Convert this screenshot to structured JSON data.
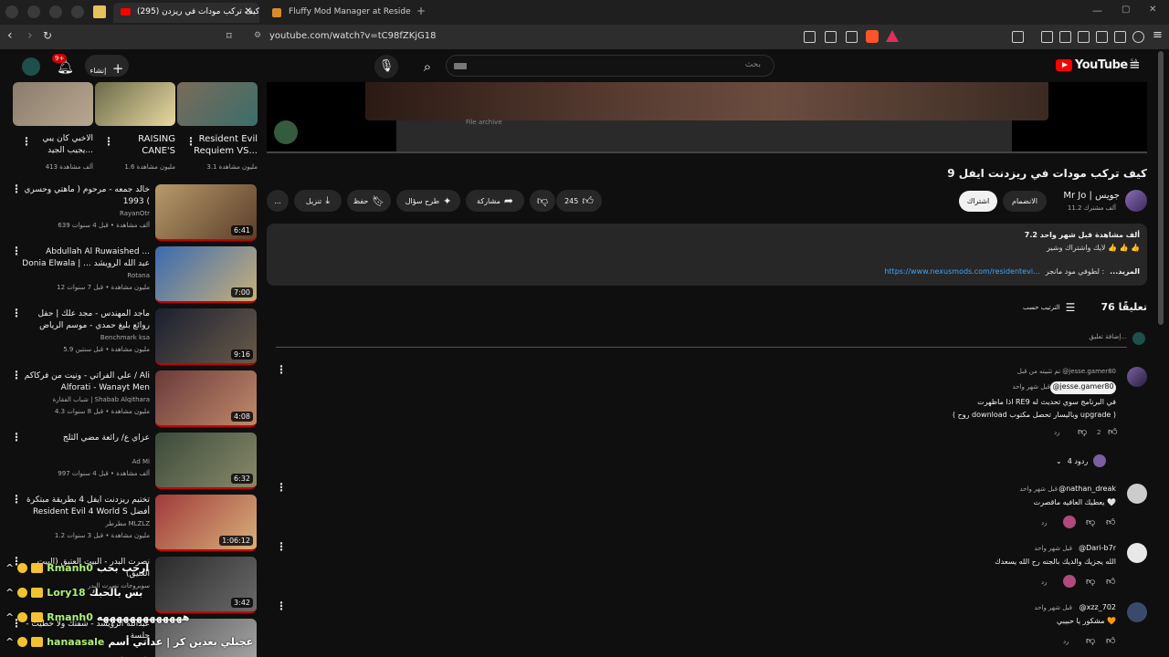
{
  "browser": {
    "tabs": [
      {
        "title": "(295) كيف تركب مودات في ريزدن"
      },
      {
        "title": "Fluffy Mod Manager at Resident Evil"
      }
    ],
    "url": "youtube.com/watch?v=tC98fZKjG18"
  },
  "header": {
    "logo": "YouTube",
    "region": "SA",
    "search_placeholder": "بحث",
    "create_label": "إنشاء",
    "notif_count": "9+"
  },
  "video": {
    "overlay_text": "File archive",
    "title": "كيف تركب مودات في ريزدنت ايفل 9",
    "channel_name": "Mr Jo | جويس",
    "subscribers": "11.2 ألف مشترك",
    "join_label": "الانضمام",
    "subscribe_label": "اشتراك",
    "likes": "245",
    "share_label": "مشاركة",
    "ask_label": "طرح سؤال",
    "save_label": "حفظ",
    "download_label": "تنزيل",
    "more_label": "..."
  },
  "description": {
    "stats": "7.2 ألف مشاهدة قبل شهر واحد",
    "line1": "لايك واشتراك وشير 👍 👍 👍",
    "link": "https://www.nexusmods.com/residentevi...",
    "link_prefix": "لطوفي مود مانجر :",
    "more": "...المزيد"
  },
  "comments": {
    "count": "76 تعليقًا",
    "sort_label": "الترتيب حسب",
    "add_placeholder": "إضافة تعليق...",
    "items": [
      {
        "pinned": "تم تثبيته من قبل @jesse.gamer80",
        "name": "@jesse.gamer80",
        "time": "قبل شهر واحد",
        "line1": "اذا ماظهرت RE9 في البرنامج سوي تحديث له",
        "line2": "( روح download وباليسار تحصل مكتوب upgrade )",
        "likes": "2",
        "reply": "رد",
        "replies": "4 ردود"
      },
      {
        "name": "@nathan_dreak",
        "time": "قبل شهر واحد",
        "text": "يعطيك العافيه ماقصرت 🤍",
        "reply": "رد"
      },
      {
        "name": "@Dari-b7r",
        "time": "قبل شهر واحد",
        "text": "الله يجزيك والديك بالجنه رح الله يسعدك",
        "reply": "رد"
      },
      {
        "name": "@xzz_702",
        "time": "قبل شهر واحد",
        "text": "مشكور يا حبيبي 🧡",
        "reply": "رد"
      }
    ]
  },
  "related_top": [
    {
      "title": "Resident Evil Requiem VS...",
      "meta": "3.1 مليون مشاهدة"
    },
    {
      "title": "RAISING CANE'S",
      "meta": "1.6 مليون مشاهدة"
    },
    {
      "title": "الاخبي كان يبي يجيب الجيد...",
      "meta": "413 ألف مشاهدة"
    }
  ],
  "related": [
    {
      "title": "خالد جمعه - مرحوم ( ماهتي وحسري ) 1993",
      "channel": "RayanOtr",
      "meta": "639 ألف مشاهدة • قبل 4 سنوات",
      "duration": "6:41"
    },
    {
      "title": "Abdullah Al Ruwaished ... Donia Elwala | عبد الله الرويشد ... دنيا الولة",
      "channel": "Rotana",
      "meta": "12 مليون مشاهدة • قبل 7 سنوات",
      "duration": "7:00"
    },
    {
      "title": "ماجد المهندس - مجد علك | حفل روائع بليغ حمدي - موسم الرياض 2023 | Majid Al",
      "channel": "Benchmark ksa",
      "meta": "5.9 مليون مشاهدة • قبل سنتين",
      "duration": "9:16"
    },
    {
      "title": "علي الفراتي - ونيت من فركاكم / Ali Alforati - Wanayt Men",
      "channel": "شباب الفقارة | Shabab Alqithara",
      "meta": "4.3 مليون مشاهدة • قبل 8 سنوات",
      "duration": "4:08"
    },
    {
      "title": "عزاي ع/ رائعة مضي الثلج",
      "channel": "Ad Mi",
      "meta": "997 ألف مشاهدة • قبل 4 سنوات",
      "duration": "6:32"
    },
    {
      "title": "تختيم ريزدنت ايفل 4 بطريقة مبتكرة Resident Evil 4 World S أفضل مو...",
      "channel": "مطرطر MLZLZ",
      "meta": "1.2 مليون مشاهدة • قبل 3 سنوات",
      "duration": "1:06:12"
    },
    {
      "title": "نصرت البدر - البيت العتيق (البيت العتيق)",
      "channel": "سوبروجات نصرت البدر",
      "meta": "",
      "duration": "3:42"
    },
    {
      "title": "عبدالله الرويشد - شفتك ولا خطيت - جلسة",
      "channel": "",
      "meta": "4.5 مليون مشاهدة",
      "duration": ""
    }
  ],
  "chat_overlay": [
    {
      "user": "Rmanh0",
      "msg": "ارحب بحب"
    },
    {
      "user": "Lory18",
      "msg": "بس بالحبك"
    },
    {
      "user": "Rmanh0",
      "msg": "هههههههههههههه"
    },
    {
      "user": "hanaasale",
      "msg": "عجبلي بعدين كر | عداتي أسم"
    }
  ],
  "colors": {
    "accent": "#ff0000",
    "bg": "#0f0f0f",
    "link": "#3ea6ff"
  }
}
